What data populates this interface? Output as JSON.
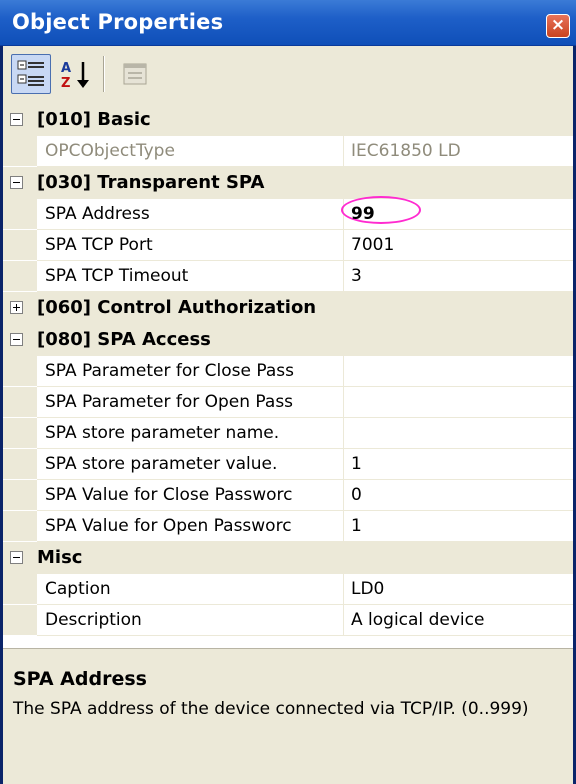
{
  "window": {
    "title": "Object Properties",
    "close_glyph": "×"
  },
  "toolbar": {
    "buttons": [
      {
        "icon": "categorized-icon",
        "pressed": true
      },
      {
        "icon": "sort-alphabetical-icon",
        "pressed": false
      },
      {
        "icon": "property-pages-icon",
        "enabled": false
      }
    ]
  },
  "categories": [
    {
      "label": "[010] Basic",
      "expanded": true,
      "rows": [
        {
          "name": "OPCObjectType",
          "value": "IEC61850 LD",
          "readonly": true
        }
      ]
    },
    {
      "label": "[030] Transparent SPA",
      "expanded": true,
      "rows": [
        {
          "name": "SPA Address",
          "value": "99",
          "highlighted": true
        },
        {
          "name": "SPA TCP Port",
          "value": "7001"
        },
        {
          "name": "SPA TCP Timeout",
          "value": "3"
        }
      ]
    },
    {
      "label": "[060] Control Authorization",
      "expanded": false,
      "rows": []
    },
    {
      "label": "[080] SPA Access",
      "expanded": true,
      "rows": [
        {
          "name": "SPA Parameter for Close Pass",
          "value": ""
        },
        {
          "name": "SPA Parameter for Open Pass",
          "value": ""
        },
        {
          "name": "SPA store parameter name.",
          "value": ""
        },
        {
          "name": "SPA store parameter value.",
          "value": "1"
        },
        {
          "name": "SPA Value for Close Passworc",
          "value": "0"
        },
        {
          "name": "SPA Value for Open Passworc",
          "value": "1"
        }
      ]
    },
    {
      "label": "Misc",
      "expanded": true,
      "rows": [
        {
          "name": "Caption",
          "value": "LD0"
        },
        {
          "name": "Description",
          "value": "A logical device"
        }
      ]
    }
  ],
  "help": {
    "title": "SPA Address",
    "description": "The SPA address of the device connected via TCP/IP. (0..999)"
  },
  "colors": {
    "titlebar": "#1e5fc8",
    "panel": "#ece9d8",
    "highlight_ring": "#ff2bd0",
    "readonly_text": "#8f8b7b"
  }
}
